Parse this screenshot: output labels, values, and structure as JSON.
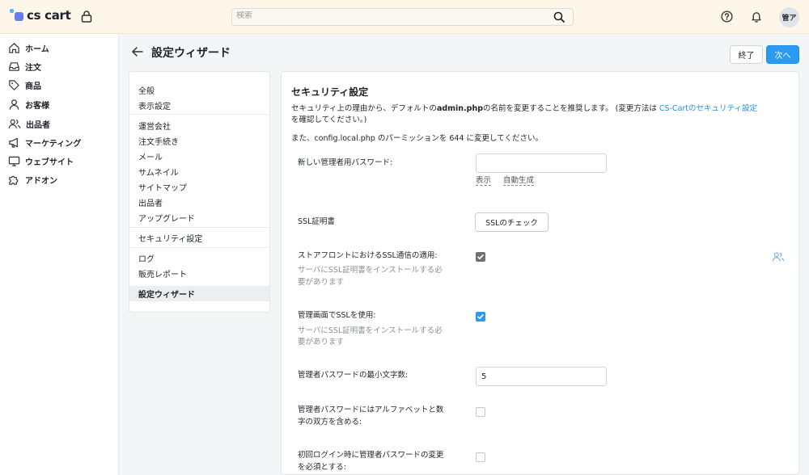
{
  "app": {
    "logo_text": "cs cart",
    "search_placeholder": "検索",
    "avatar_initials": "管ア"
  },
  "nav": {
    "items": [
      {
        "label": "ホーム",
        "icon": "home-icon"
      },
      {
        "label": "注文",
        "icon": "inbox-icon"
      },
      {
        "label": "商品",
        "icon": "tag-icon"
      },
      {
        "label": "お客様",
        "icon": "user-icon"
      },
      {
        "label": "出品者",
        "icon": "users-icon"
      },
      {
        "label": "マーケティング",
        "icon": "megaphone-icon"
      },
      {
        "label": "ウェブサイト",
        "icon": "monitor-icon"
      },
      {
        "label": "アドオン",
        "icon": "puzzle-icon"
      }
    ]
  },
  "page": {
    "title": "設定ウィザード",
    "btn_end": "終了",
    "btn_next": "次へ"
  },
  "sidepanel": {
    "items": [
      "全般",
      "表示設定",
      "運営会社",
      "注文手続き",
      "メール",
      "サムネイル",
      "サイトマップ",
      "出品者",
      "アップグレード",
      "セキュリティ設定",
      "ログ",
      "販売レポート",
      "設定ウィザード"
    ],
    "active": "設定ウィザード"
  },
  "security": {
    "title": "セキュリティ設定",
    "desc1_before": "セキュリティ上の理由から、デフォルトの",
    "desc1_bold": "admin.php",
    "desc1_after": "の名前を変更することを推奨します。 (変更方法は ",
    "desc1_link": "CS-Cartのセキュリティ設定",
    "desc2": "を確認してください。)",
    "desc3": "また、config.local.php のパーミッションを 644 に変更してください。",
    "new_password_label": "新しい管理者用パスワード:",
    "new_password_value": "",
    "show_link": "表示",
    "generate_link": "自動生成",
    "ssl_cert_label": "SSL証明書",
    "ssl_check_button": "SSLのチェック",
    "storefront_ssl_label": "ストアフロントにおけるSSL通信の適用:",
    "storefront_ssl_hint1": "サーバにSSL証明書をインストールする必",
    "storefront_ssl_hint2": "要があります",
    "storefront_ssl_checked": true,
    "admin_ssl_label": "管理画面でSSLを使用:",
    "admin_ssl_hint1": "サーバにSSL証明書をインストールする必",
    "admin_ssl_hint2": "要があります",
    "admin_ssl_checked": true,
    "min_length_label": "管理者パスワードの最小文字数:",
    "min_length_value": "5",
    "alnum_label1": "管理者パスワードにはアルファベットと数",
    "alnum_label2": "字の双方を含める:",
    "alnum_checked": false,
    "change_first_label1": "初回ログイン時に管理者パスワードの変更",
    "change_first_label2": "を必須とする:",
    "change_first_checked": false
  },
  "colors": {
    "accent": "#2a9bf0",
    "topbar_bg": "#fdf6e9",
    "link": "#2b8fd9"
  }
}
